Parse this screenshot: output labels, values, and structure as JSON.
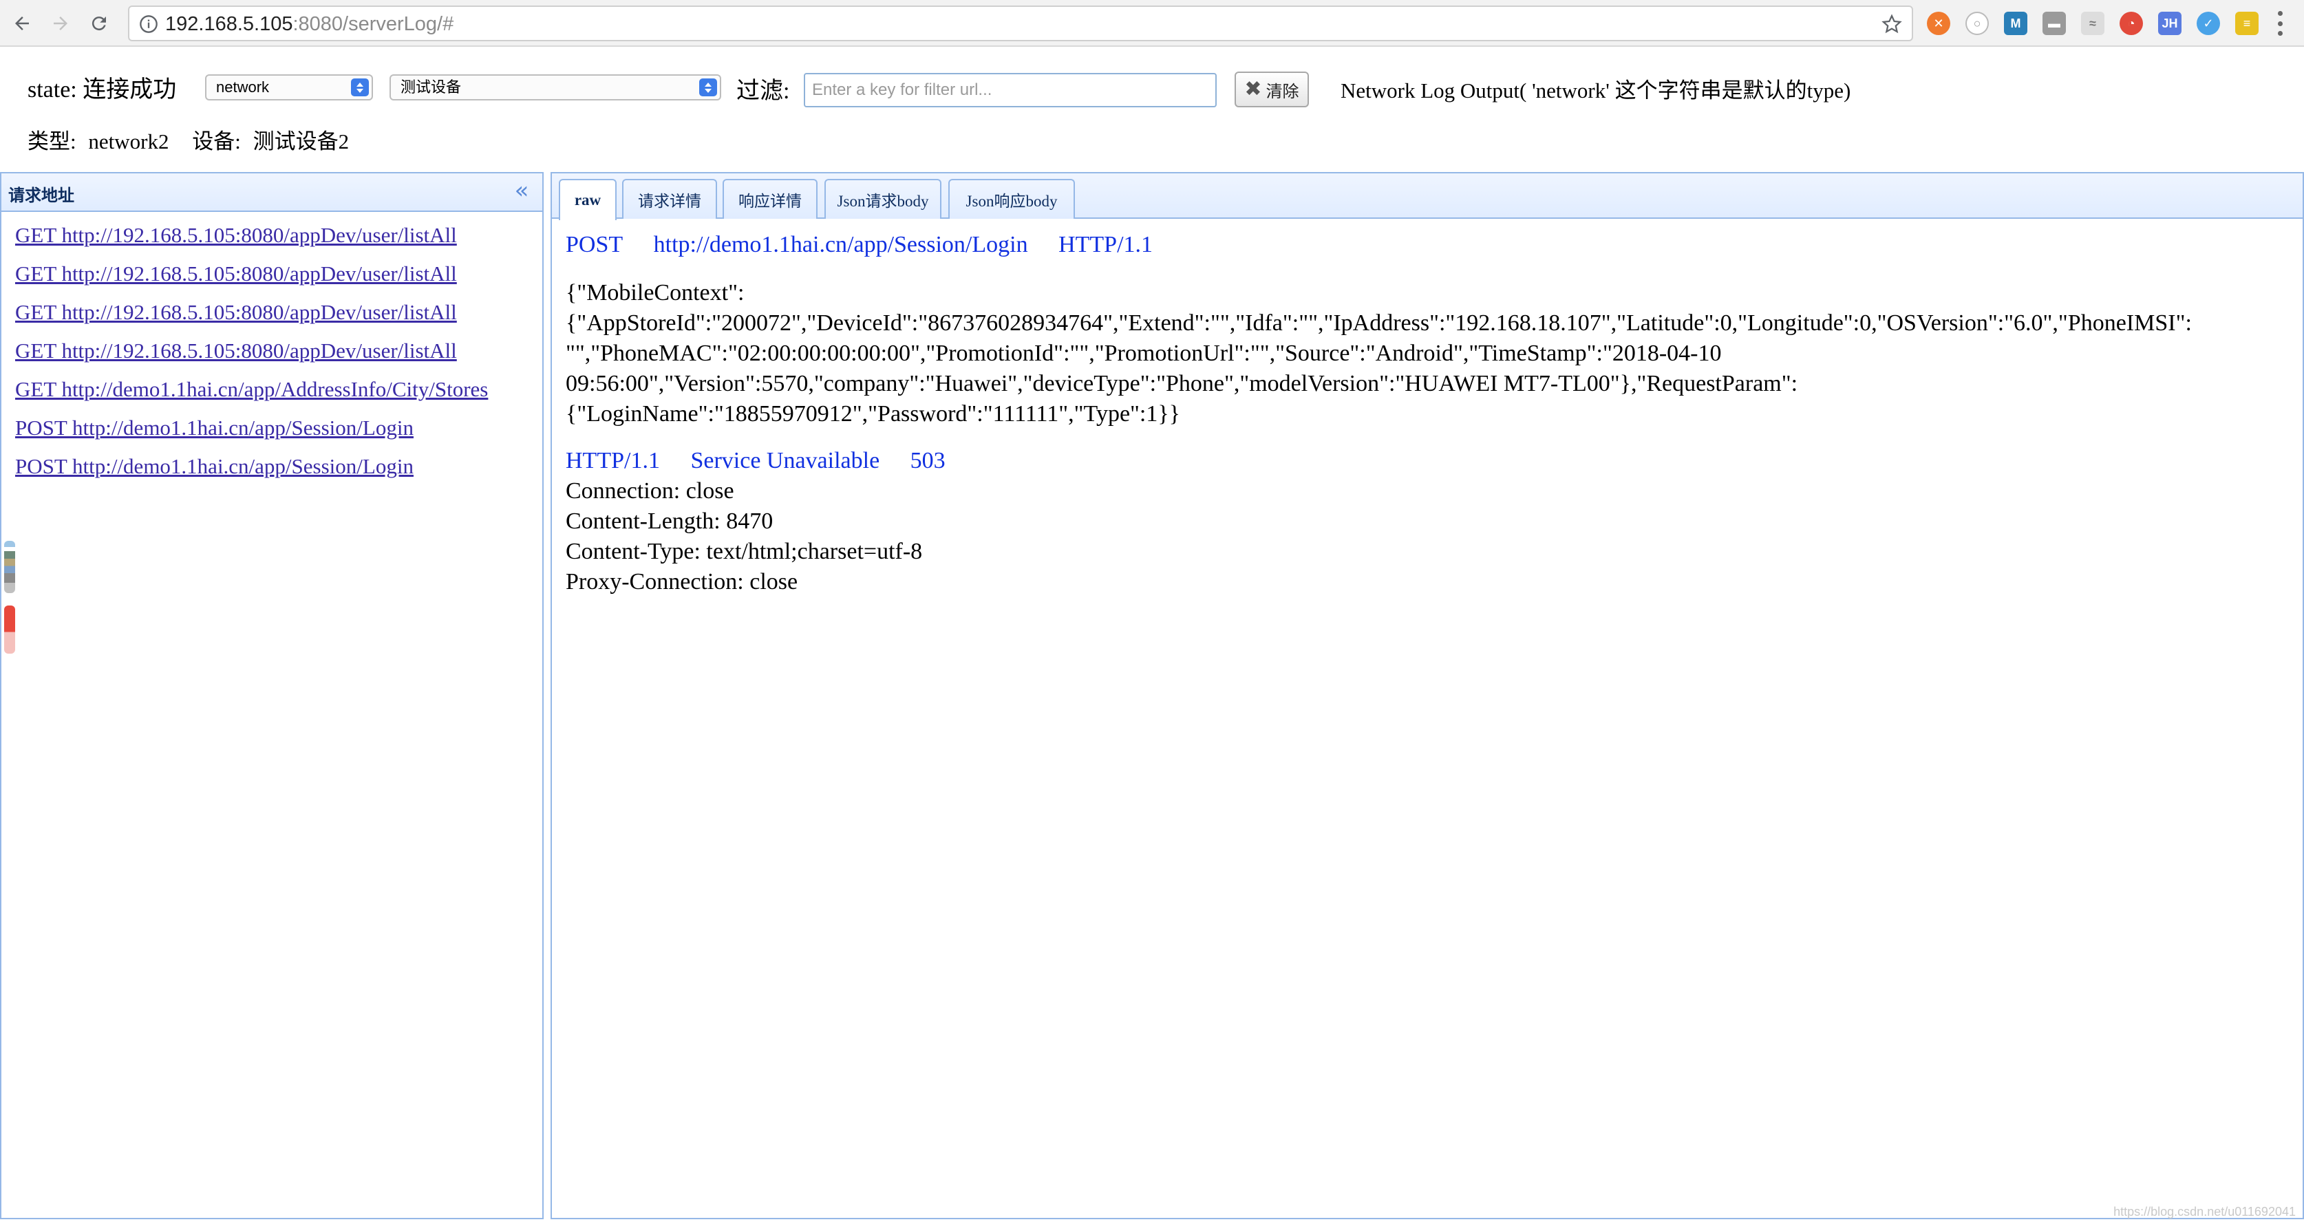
{
  "browser": {
    "url_host": "192.168.5.105",
    "url_path": ":8080/serverLog/#"
  },
  "controls": {
    "state_label": "state:",
    "state_value": "连接成功",
    "type_select_value": "network",
    "device_select_value": "测试设备",
    "filter_label": "过滤:",
    "filter_placeholder": "Enter a key for filter url...",
    "clear_label": "清除",
    "description": "Network Log Output( 'network' 这个字符串是默认的type)",
    "type_info_label": "类型:",
    "type_info_value": "network2",
    "device_info_label": "设备:",
    "device_info_value": "测试设备2"
  },
  "left_panel": {
    "title": "请求地址",
    "requests": [
      "GET http://192.168.5.105:8080/appDev/user/listAll",
      "GET http://192.168.5.105:8080/appDev/user/listAll",
      "GET http://192.168.5.105:8080/appDev/user/listAll",
      "GET http://192.168.5.105:8080/appDev/user/listAll",
      "GET http://demo1.1hai.cn/app/AddressInfo/City/Stores",
      "POST http://demo1.1hai.cn/app/Session/Login",
      "POST http://demo1.1hai.cn/app/Session/Login"
    ]
  },
  "tabs": [
    "raw",
    "请求详情",
    "响应详情",
    "Json请求body",
    "Json响应body"
  ],
  "content": {
    "method": "POST",
    "request_url": "http://demo1.1hai.cn/app/Session/Login",
    "request_protocol": "HTTP/1.1",
    "body_lines": [
      "{\"MobileContext\":",
      "{\"AppStoreId\":\"200072\",\"DeviceId\":\"867376028934764\",\"Extend\":\"\",\"Idfa\":\"\",\"IpAddress\":\"192.168.18.107\",\"Latitude\":0,\"Longitude\":0,\"OSVersion\":\"6.0\",\"PhoneIMSI\":",
      "\"\",\"PhoneMAC\":\"02:00:00:00:00:00\",\"PromotionId\":\"\",\"PromotionUrl\":\"\",\"Source\":\"Android\",\"TimeStamp\":\"2018-04-10",
      "09:56:00\",\"Version\":5570,\"company\":\"Huawei\",\"deviceType\":\"Phone\",\"modelVersion\":\"HUAWEI MT7-TL00\"},\"RequestParam\":",
      "{\"LoginName\":\"18855970912\",\"Password\":\"111111\",\"Type\":1}}"
    ],
    "response_protocol": "HTTP/1.1",
    "response_status_text": "Service Unavailable",
    "response_status_code": "503",
    "response_headers": [
      "Connection: close",
      "Content-Length: 8470",
      "Content-Type: text/html;charset=utf-8",
      "Proxy-Connection: close"
    ]
  },
  "watermark": "https://blog.csdn.net/u011692041",
  "colors": {
    "link": "#3a2ba6",
    "http_blue": "#1030e0",
    "panel_border": "#95b8e7",
    "select_arrow": "#3d7ce8"
  }
}
